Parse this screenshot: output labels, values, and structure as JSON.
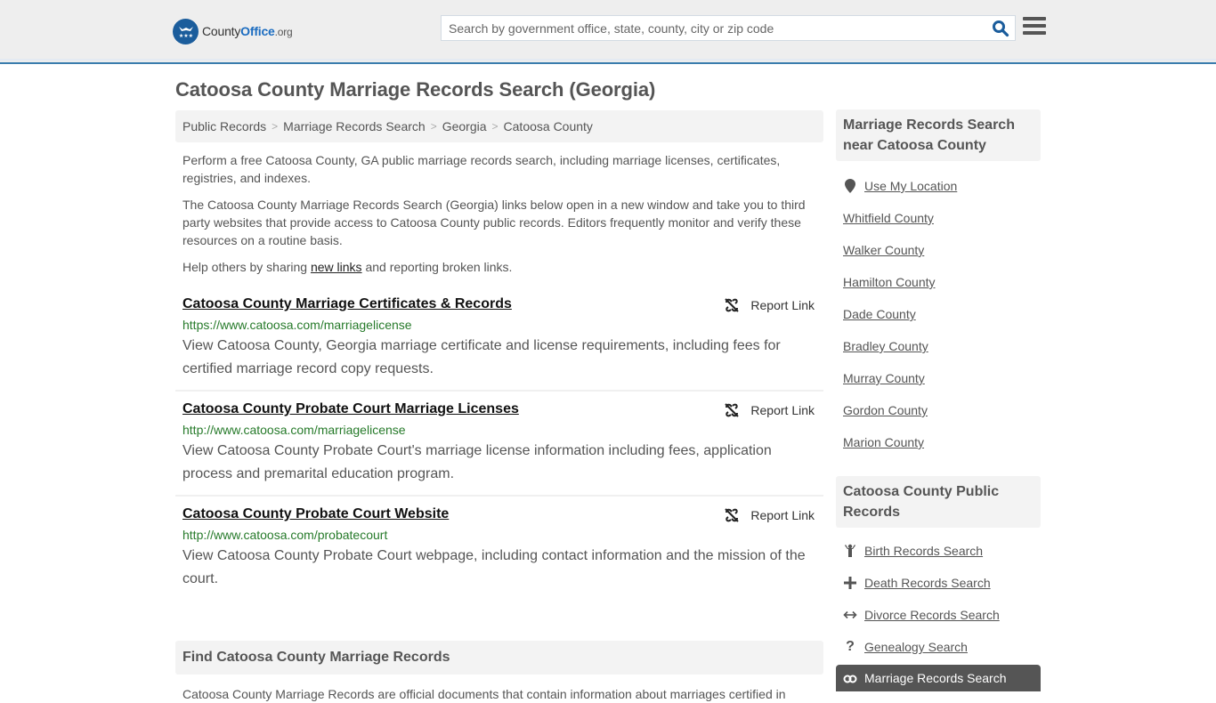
{
  "header": {
    "logo": {
      "county": "County",
      "office": "Office",
      "tld": ".org"
    },
    "search": {
      "placeholder": "Search by government office, state, county, city or zip code",
      "value": ""
    },
    "icons": {
      "search": "search-icon",
      "menu": "hamburger-menu-icon",
      "logo": "eagle-stars-logo-icon"
    }
  },
  "page_title": "Catoosa County Marriage Records Search (Georgia)",
  "breadcrumb": [
    "Public Records",
    "Marriage Records Search",
    "Georgia",
    "Catoosa County"
  ],
  "intro": {
    "p1": "Perform a free Catoosa County, GA public marriage records search, including marriage licenses, certificates, registries, and indexes.",
    "p2": "The Catoosa County Marriage Records Search (Georgia) links below open in a new window and take you to third party websites that provide access to Catoosa County public records. Editors frequently monitor and verify these resources on a routine basis.",
    "p3_before": "Help others by sharing ",
    "p3_link": "new links",
    "p3_after": " and reporting broken links."
  },
  "results": [
    {
      "title": "Catoosa County Marriage Certificates & Records",
      "url": "https://www.catoosa.com/marriagelicense",
      "description": "View Catoosa County, Georgia marriage certificate and license requirements, including fees for certified marriage record copy requests.",
      "report_label": "Report Link"
    },
    {
      "title": "Catoosa County Probate Court Marriage Licenses",
      "url": "http://www.catoosa.com/marriagelicense",
      "description": "View Catoosa County Probate Court's marriage license information including fees, application process and premarital education program.",
      "report_label": "Report Link"
    },
    {
      "title": "Catoosa County Probate Court Website",
      "url": "http://www.catoosa.com/probatecourt",
      "description": "View Catoosa County Probate Court webpage, including contact information and the mission of the court.",
      "report_label": "Report Link"
    }
  ],
  "find_section": {
    "heading": "Find Catoosa County Marriage Records",
    "text": "Catoosa County Marriage Records are official documents that contain information about marriages certified in"
  },
  "sidebar": {
    "nearby": {
      "heading": "Marriage Records Search near Catoosa County",
      "use_location": "Use My Location",
      "counties": [
        "Whitfield County",
        "Walker County",
        "Hamilton County",
        "Dade County",
        "Bradley County",
        "Murray County",
        "Gordon County",
        "Marion County"
      ]
    },
    "public_records": {
      "heading": "Catoosa County Public Records",
      "items": [
        {
          "label": "Birth Records Search",
          "icon": "child-icon"
        },
        {
          "label": "Death Records Search",
          "icon": "plus-icon"
        },
        {
          "label": "Divorce Records Search",
          "icon": "double-arrow-icon"
        },
        {
          "label": "Genealogy Search",
          "icon": "question-icon"
        },
        {
          "label": "Marriage Records Search",
          "icon": "rings-icon",
          "active": true
        }
      ]
    }
  },
  "colors": {
    "accent": "#3a7cad",
    "url_green": "#267a2a",
    "header_bg": "#eeeeee",
    "panel_bg": "#f3f3f3",
    "active_bg": "#555555"
  }
}
